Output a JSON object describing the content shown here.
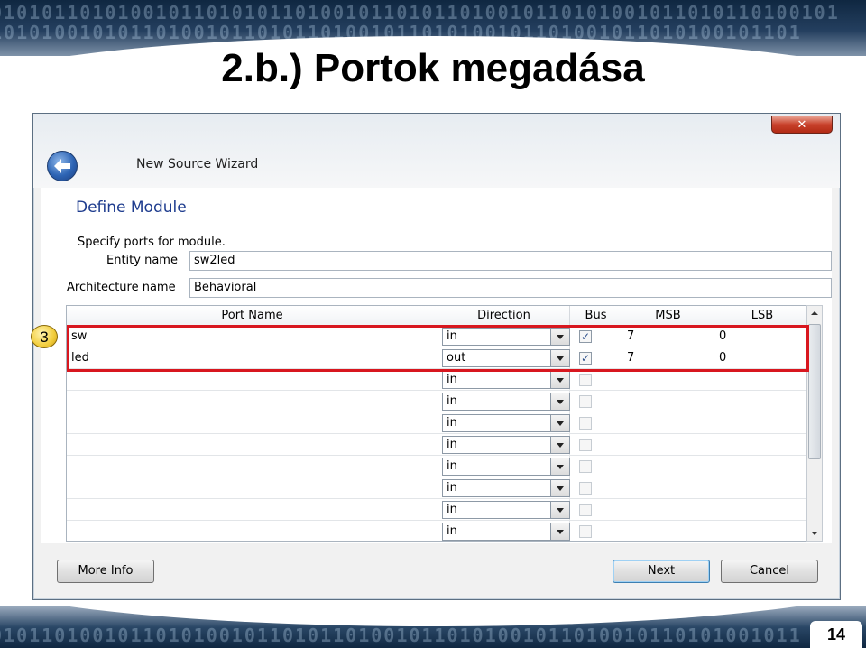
{
  "slide": {
    "title": "2.b.) Portok megadása",
    "page_number": "14",
    "step_badge": "3"
  },
  "window": {
    "close_symbol": "✕",
    "wizard_title": "New Source Wizard",
    "section_title": "Define Module",
    "instruction": "Specify ports for module.",
    "entity_label": "Entity name",
    "entity_value": "sw2led",
    "architecture_label": "Architecture name",
    "architecture_value": "Behavioral"
  },
  "ports_table": {
    "headers": {
      "port_name": "Port Name",
      "direction": "Direction",
      "bus": "Bus",
      "msb": "MSB",
      "lsb": "LSB"
    },
    "rows": [
      {
        "name": "sw",
        "direction": "in",
        "bus": true,
        "msb": "7",
        "lsb": "0"
      },
      {
        "name": "led",
        "direction": "out",
        "bus": true,
        "msb": "7",
        "lsb": "0"
      },
      {
        "name": "",
        "direction": "in",
        "bus": false,
        "msb": "",
        "lsb": ""
      },
      {
        "name": "",
        "direction": "in",
        "bus": false,
        "msb": "",
        "lsb": ""
      },
      {
        "name": "",
        "direction": "in",
        "bus": false,
        "msb": "",
        "lsb": ""
      },
      {
        "name": "",
        "direction": "in",
        "bus": false,
        "msb": "",
        "lsb": ""
      },
      {
        "name": "",
        "direction": "in",
        "bus": false,
        "msb": "",
        "lsb": ""
      },
      {
        "name": "",
        "direction": "in",
        "bus": false,
        "msb": "",
        "lsb": ""
      },
      {
        "name": "",
        "direction": "in",
        "bus": false,
        "msb": "",
        "lsb": ""
      },
      {
        "name": "",
        "direction": "in",
        "bus": false,
        "msb": "",
        "lsb": ""
      }
    ]
  },
  "buttons": {
    "more_info": "More Info",
    "next": "Next",
    "cancel": "Cancel"
  },
  "colors": {
    "highlight": "#d8171f",
    "section_title": "#1e3c8e"
  }
}
